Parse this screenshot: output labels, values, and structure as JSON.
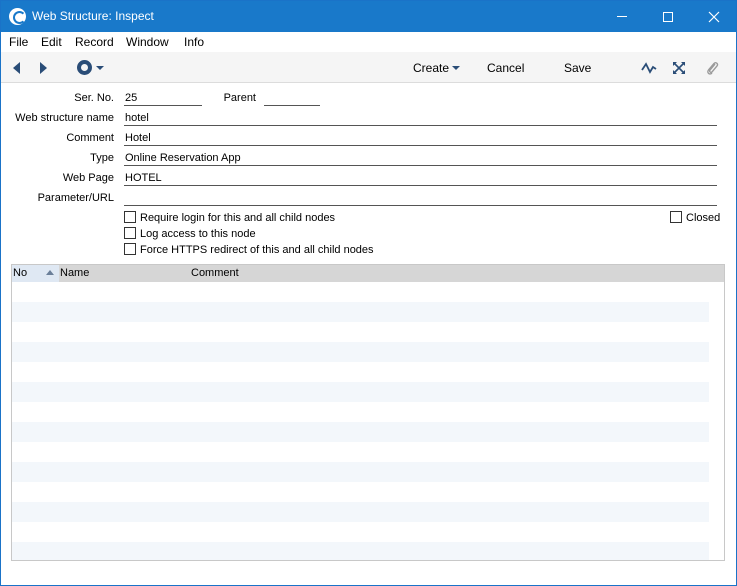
{
  "window": {
    "title": "Web Structure: Inspect"
  },
  "menu": {
    "items": [
      "File",
      "Edit",
      "Record",
      "Window",
      "Info"
    ]
  },
  "toolbar": {
    "create_label": "Create",
    "cancel_label": "Cancel",
    "save_label": "Save",
    "icons": [
      "back-arrow-icon",
      "forward-arrow-icon",
      "gear-icon",
      "activity-icon",
      "expand-icon",
      "paperclip-icon"
    ]
  },
  "form": {
    "ser_no": {
      "label": "Ser. No.",
      "value": "25"
    },
    "parent": {
      "label": "Parent",
      "value": ""
    },
    "web_structure_name": {
      "label": "Web structure name",
      "value": "hotel"
    },
    "comment": {
      "label": "Comment",
      "value": "Hotel"
    },
    "type": {
      "label": "Type",
      "value": "Online Reservation App"
    },
    "web_page": {
      "label": "Web Page",
      "value": "HOTEL"
    },
    "parameter_url": {
      "label": "Parameter/URL",
      "value": ""
    },
    "checkboxes": {
      "require_login": {
        "label": "Require login for this and all child nodes",
        "checked": false
      },
      "log_access": {
        "label": "Log access to this node",
        "checked": false
      },
      "force_https": {
        "label": "Force HTTPS redirect of this and all child nodes",
        "checked": false
      },
      "closed": {
        "label": "Closed",
        "checked": false
      }
    }
  },
  "grid": {
    "columns": [
      "No",
      "Name",
      "Comment"
    ],
    "rows": []
  },
  "colors": {
    "titlebar": "#1979ca",
    "row_alt": "#f3f7fb",
    "header": "#d6d6d6"
  }
}
